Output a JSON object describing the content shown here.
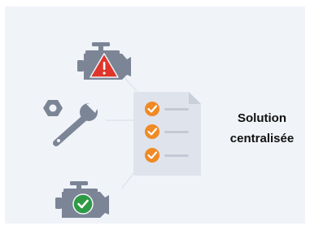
{
  "caption": {
    "line1": "Solution",
    "line2": "centralisée"
  },
  "icons": {
    "engine_warning": "engine-warning-icon",
    "tools": "wrench-nut-icon",
    "engine_ok": "engine-ok-icon",
    "checklist": "checklist-document-icon"
  },
  "checklist": {
    "checked_items": 3
  },
  "colors": {
    "panel_background": "#f0f3f8",
    "icon_gray": "#7b8596",
    "warning_red": "#e0352b",
    "ok_green": "#2e9a43",
    "check_orange": "#f08a24",
    "document": "#dfe4ec",
    "text": "#111111"
  }
}
